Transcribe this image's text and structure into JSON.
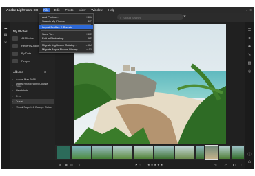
{
  "menubar": {
    "app": "Adobe Lightroom CC",
    "items": [
      "File",
      "Edit",
      "Photo",
      "View",
      "Window",
      "Help"
    ]
  },
  "search": {
    "placeholder": "Cloud Search"
  },
  "file_menu": {
    "items": [
      {
        "label": "Add Photos…",
        "shortcut": "⇧⌘A"
      },
      {
        "label": "Search My Photos",
        "shortcut": "⌘F"
      },
      {
        "label": "Import Profiles & Presets…",
        "shortcut": ""
      },
      {
        "label": "Save To…",
        "shortcut": "⇧⌘E"
      },
      {
        "label": "Edit in Photoshop…",
        "shortcut": "⌘E"
      },
      {
        "label": "Migrate Lightroom Catalog…",
        "shortcut": "⌥⌘M"
      },
      {
        "label": "Migrate Apple Photos Library…",
        "shortcut": "⌥⌘I"
      }
    ]
  },
  "sidebar": {
    "title": "My Photos",
    "rows": [
      {
        "label": "All Photos"
      },
      {
        "label": "Recently Added"
      },
      {
        "label": "By Date"
      },
      {
        "label": "People"
      }
    ],
    "albums_title": "Albums",
    "albums_actions": "⊞ +",
    "albums": [
      {
        "label": "Adobe Max 2018",
        "arrow": "›"
      },
      {
        "label": "Digital Photography Course 2018",
        "arrow": "›"
      },
      {
        "label": "Headshots",
        "arrow": "›"
      },
      {
        "label": "Print",
        "arrow": "›"
      },
      {
        "label": "Travel",
        "arrow": "›"
      },
      {
        "label": "Visual Superb & Escape Guide",
        "arrow": "›"
      }
    ]
  },
  "bottom": {
    "rating_stars": "★ ★ ★ ★ ★",
    "flags": "⚑ ⚐",
    "view_label": "⊞",
    "fit": "Fit"
  },
  "icons": {
    "rail_left": [
      "cloud-icon",
      "library-icon",
      "people-icon"
    ],
    "rail_right": [
      "edit-sliders-icon",
      "crop-icon",
      "healing-icon",
      "brush-icon",
      "gradient-icon",
      "radial-icon",
      "info-icon",
      "comment-icon"
    ]
  }
}
